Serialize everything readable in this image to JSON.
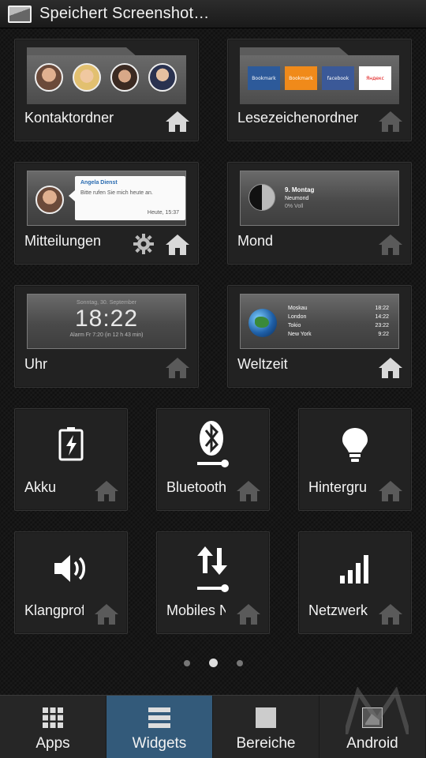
{
  "status_bar": {
    "title": "Speichert Screenshot…"
  },
  "widgets": {
    "contacts": {
      "label": "Kontaktordner"
    },
    "bookmarks": {
      "label": "Lesezeichenordner",
      "items": [
        "Bookmark",
        "Bookmark",
        "facebook",
        "Яндекс"
      ]
    },
    "notifications": {
      "label": "Mitteilungen",
      "sender": "Angela Dienst",
      "message": "Bitte rufen Sie mich heute an.",
      "time": "Heute, 15:37"
    },
    "moon": {
      "label": "Mond",
      "date": "9. Montag",
      "phase": "Neumond",
      "percent": "0% Voll"
    },
    "clock": {
      "label": "Uhr",
      "date": "Sonntag, 30. September",
      "time": "18:22",
      "alarm": "Alarm Fr 7:20 (in 12 h 43 min)"
    },
    "worldtime": {
      "label": "Weltzeit",
      "cities": [
        {
          "name": "Moskau",
          "time": "18:22"
        },
        {
          "name": "London",
          "time": "14:22"
        },
        {
          "name": "Tokio",
          "time": "23:22"
        },
        {
          "name": "New York",
          "time": "9:22"
        }
      ]
    },
    "battery": {
      "label": "Akku"
    },
    "bluetooth": {
      "label": "Bluetooth"
    },
    "background": {
      "label": "Hintergrund"
    },
    "sound": {
      "label": "Klangprofil"
    },
    "mobile": {
      "label": "Mobiles Netz"
    },
    "network": {
      "label": "Netzwerk"
    }
  },
  "pager": {
    "pages": 3,
    "active": 2
  },
  "tabs": [
    {
      "label": "Apps",
      "icon": "grid-icon"
    },
    {
      "label": "Widgets",
      "icon": "list-icon",
      "active": true
    },
    {
      "label": "Bereiche",
      "icon": "square-icon"
    },
    {
      "label": "Android",
      "icon": "android-icon"
    }
  ],
  "colors": {
    "active_tab": "#335a7a",
    "tile_bg": "#222222"
  }
}
